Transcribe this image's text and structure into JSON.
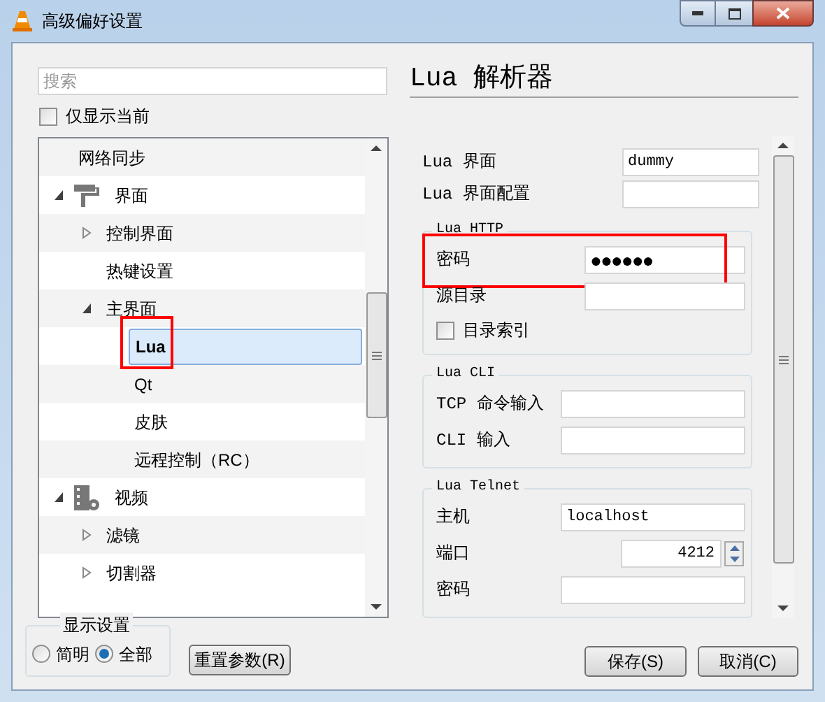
{
  "window": {
    "title": "高级偏好设置"
  },
  "search": {
    "placeholder": "搜索"
  },
  "only_current": {
    "label": "仅显示当前",
    "checked": false
  },
  "tree": [
    {
      "children": [
        {
          "label": "网络同步"
        }
      ]
    },
    {
      "label": "界面",
      "kind": "interface",
      "expanded": true,
      "children": [
        {
          "label": "控制界面",
          "expanded": false
        },
        {
          "label": "热键设置"
        },
        {
          "label": "主界面",
          "expanded": true,
          "children": [
            {
              "label": "Lua",
              "selected": true,
              "highlighted": true
            },
            {
              "label": "Qt",
              "selected": false
            },
            {
              "label": "皮肤",
              "selected": false
            },
            {
              "label": "远程控制（RC）",
              "selected": false
            }
          ]
        }
      ]
    },
    {
      "label": "视频",
      "kind": "video",
      "expanded": true,
      "children": [
        {
          "label": "滤镜",
          "expanded": false
        },
        {
          "label": "切割器",
          "expanded": false
        }
      ]
    }
  ],
  "panel": {
    "title": "Lua 解析器",
    "fields": [
      {
        "kind": "text",
        "label": "Lua 界面",
        "value": "dummy"
      },
      {
        "kind": "text",
        "label": "Lua 界面配置"
      }
    ],
    "groups": [
      {
        "title": "Lua HTTP",
        "fields": [
          {
            "kind": "password",
            "label": "密码",
            "value": "●●●●●●",
            "highlighted": true
          },
          {
            "kind": "text",
            "label": "源目录"
          },
          {
            "kind": "checkbox",
            "label": "目录索引",
            "checked": false
          }
        ]
      },
      {
        "title": "Lua CLI",
        "fields": [
          {
            "kind": "text",
            "label": "TCP 命令输入"
          },
          {
            "kind": "text",
            "label": "CLI 输入"
          }
        ]
      },
      {
        "title": "Lua Telnet",
        "fields": [
          {
            "kind": "text",
            "label": "主机",
            "value": "localhost"
          },
          {
            "kind": "spin",
            "label": "端口",
            "value": "4212"
          },
          {
            "kind": "text",
            "label": "密码"
          }
        ]
      }
    ]
  },
  "display_settings": {
    "title": "显示设置",
    "options": [
      {
        "label": "简明",
        "selected": false
      },
      {
        "label": "全部",
        "selected": true
      }
    ]
  },
  "buttons": [
    {
      "label": "重置参数(R)",
      "kind": "reset"
    },
    {
      "label": "保存(S)",
      "kind": "save"
    },
    {
      "label": "取消(C)",
      "kind": "cancel"
    }
  ]
}
